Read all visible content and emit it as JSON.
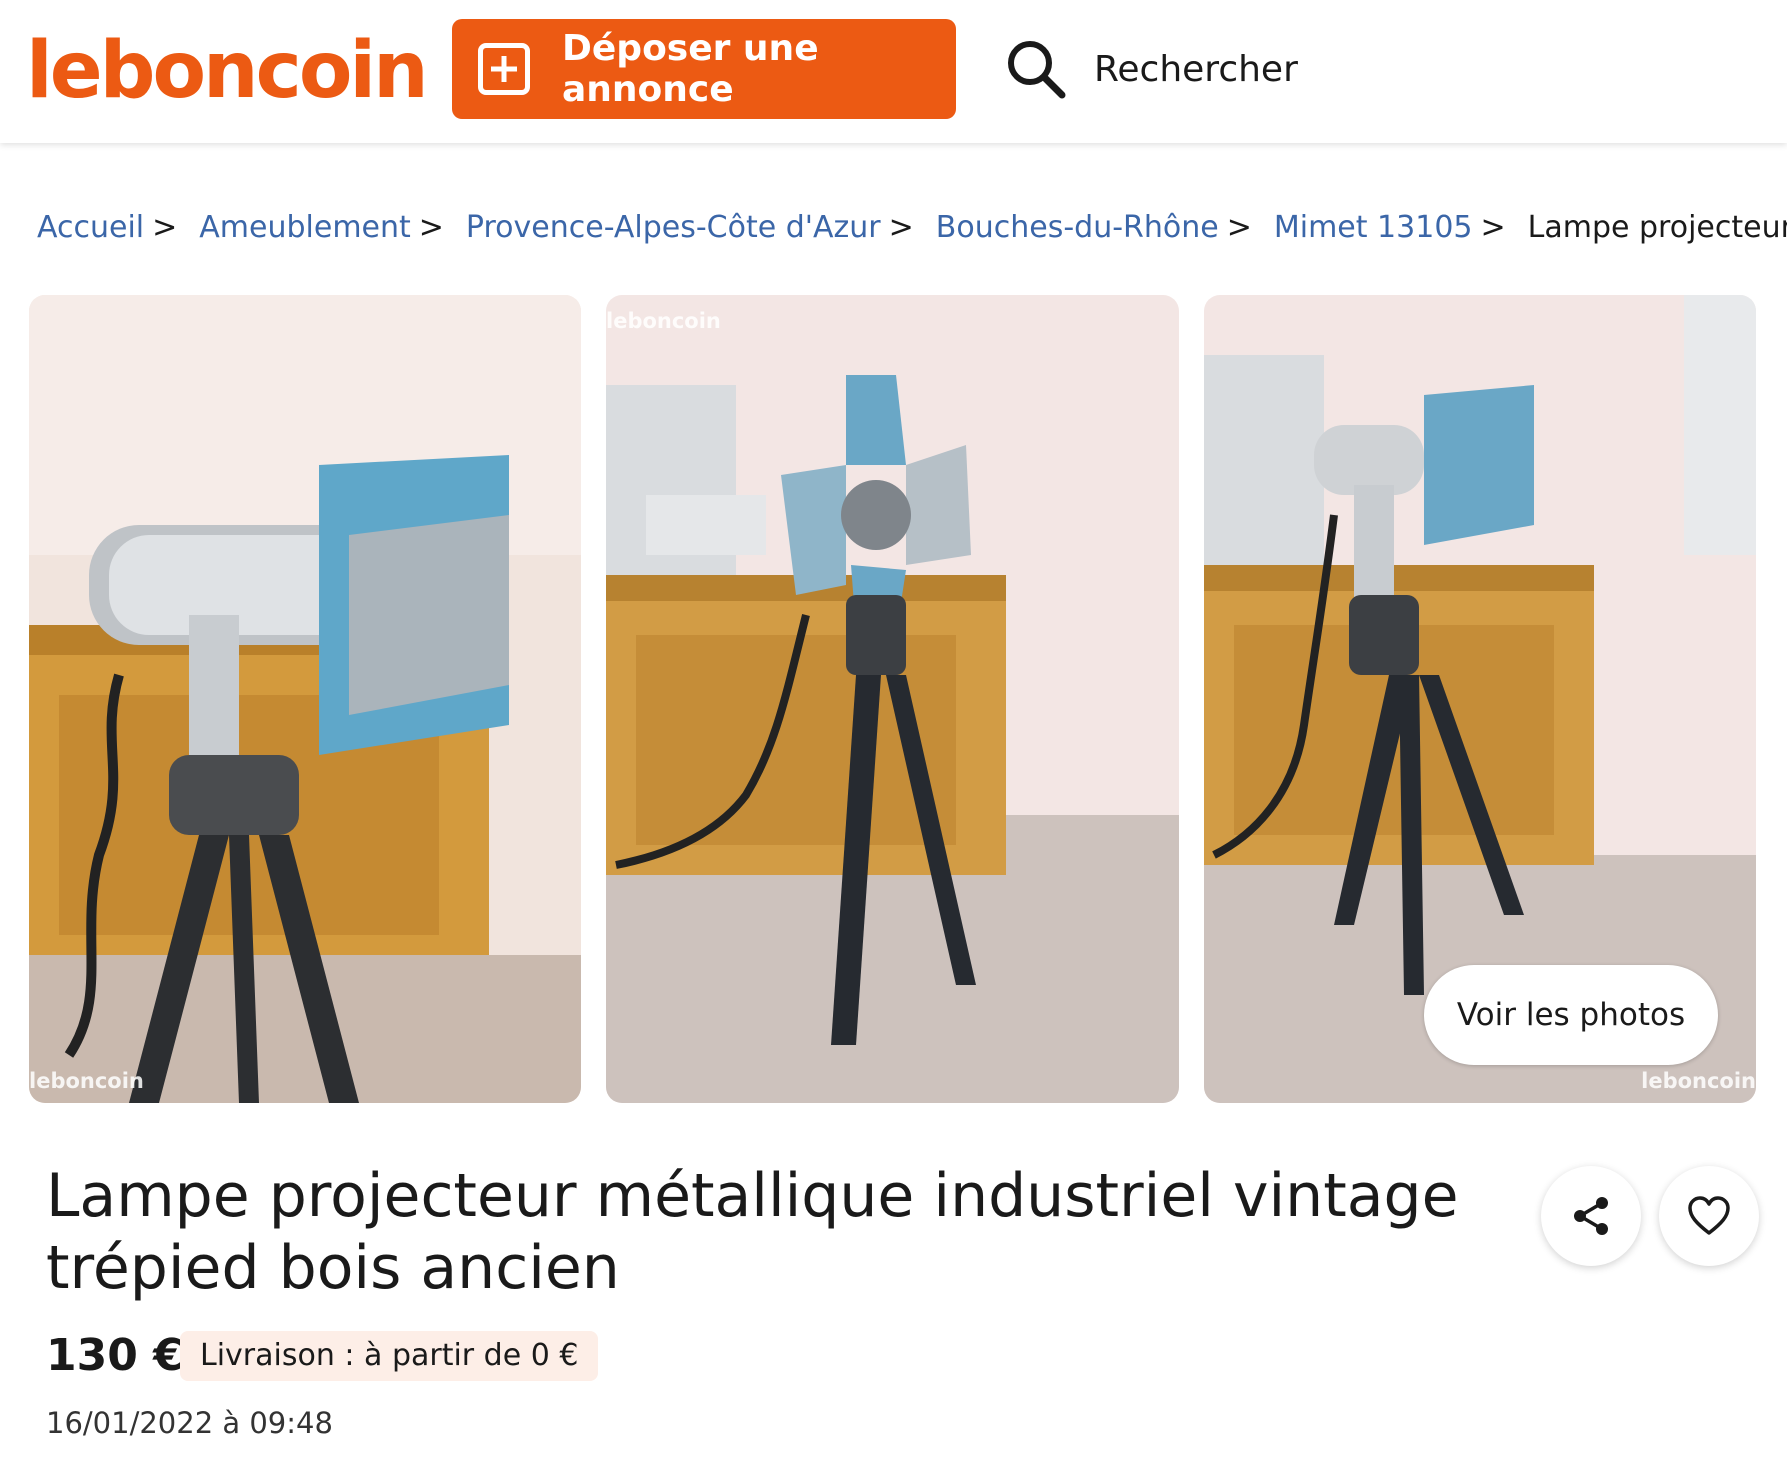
{
  "header": {
    "logo": "leboncoin",
    "post_ad_label": "Déposer une annonce",
    "search_label": "Rechercher"
  },
  "breadcrumb": [
    "Accueil",
    "Ameublement",
    "Provence-Alpes-Côte d'Azur",
    "Bouches-du-Rhône",
    "Mimet 13105",
    "Lampe projecteur métallique industriel vintage trépied bois ancien"
  ],
  "breadcrumb_separator": ">",
  "photos": {
    "watermark": "leboncoin",
    "view_photos_label": "Voir les photos"
  },
  "listing": {
    "title": "Lampe projecteur métallique industriel vintage trépied bois ancien",
    "price": "130 €",
    "delivery": "Livraison : à partir de 0 €",
    "date": "16/01/2022 à 09:48"
  },
  "colors": {
    "brand": "#ec5a13",
    "link": "#3b66a8",
    "delivery_bg": "#fdeee7"
  }
}
